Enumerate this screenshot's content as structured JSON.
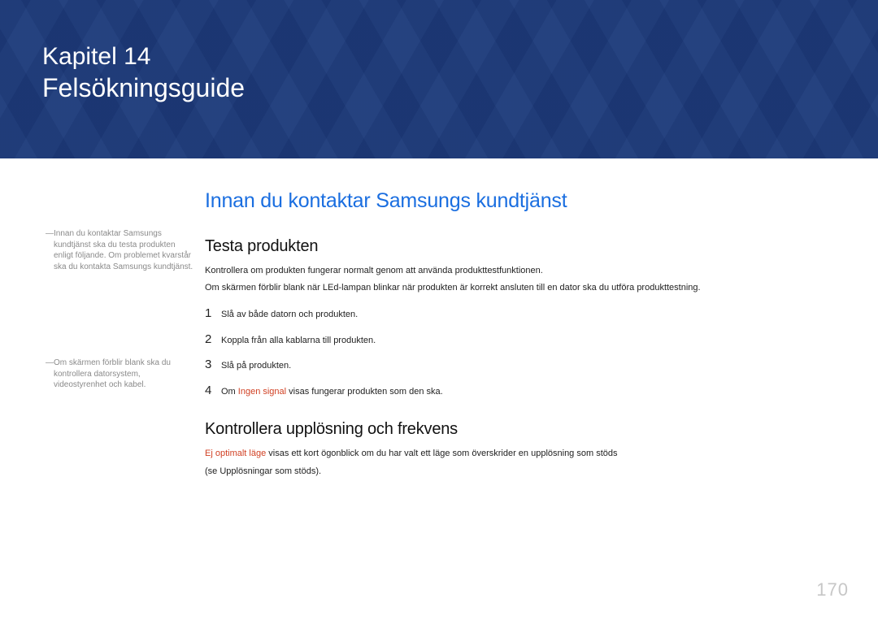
{
  "hero": {
    "chapter_label": "Kapitel 14",
    "chapter_title": "Felsökningsguide"
  },
  "sidebar": {
    "note1": "Innan du kontaktar Samsungs kundtjänst ska du testa produkten enligt följande. Om problemet kvarstår ska du kontakta Samsungs kundtjänst.",
    "note2": "Om skärmen förblir blank ska du kontrollera datorsystem, videostyrenhet och kabel."
  },
  "main": {
    "section_title": "Innan du kontaktar Samsungs kundtjänst",
    "test_heading": "Testa produkten",
    "test_p1": "Kontrollera om produkten fungerar normalt genom att använda produkttestfunktionen.",
    "test_p2": "Om skärmen förblir blank när LEd-lampan blinkar när produkten är korrekt ansluten till en dator ska du utföra produkttestning.",
    "steps": {
      "1": "Slå av både datorn och produkten.",
      "2": "Koppla från alla kablarna till produkten.",
      "3": "Slå på produkten.",
      "4_prefix": "Om ",
      "4_term": "Ingen signal",
      "4_suffix": " visas fungerar produkten som den ska."
    },
    "res_heading": "Kontrollera upplösning och frekvens",
    "res_term": "Ej optimalt läge",
    "res_suffix": " visas ett kort ögonblick om du har valt ett läge som överskrider en upplösning som stöds",
    "res_p2": "(se Upplösningar som stöds)."
  },
  "page_number": "170"
}
